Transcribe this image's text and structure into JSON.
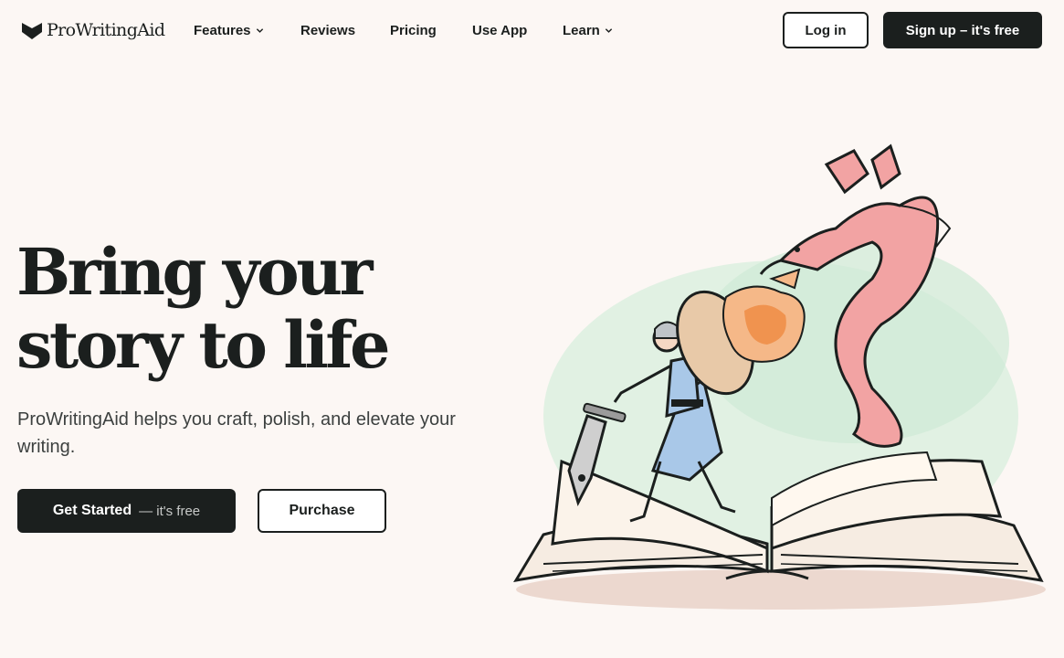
{
  "brand": {
    "name": "ProWritingAid"
  },
  "nav": {
    "items": [
      {
        "label": "Features",
        "dropdown": true
      },
      {
        "label": "Reviews",
        "dropdown": false
      },
      {
        "label": "Pricing",
        "dropdown": false
      },
      {
        "label": "Use App",
        "dropdown": false
      },
      {
        "label": "Learn",
        "dropdown": true
      }
    ],
    "login_label": "Log in",
    "signup_label": "Sign up – it's free"
  },
  "hero": {
    "headline_line1": "Bring your",
    "headline_line2": "story to life",
    "subtext": "ProWritingAid helps you craft, polish, and elevate your writing.",
    "cta_primary_main": "Get Started",
    "cta_primary_sub": "— it's free",
    "cta_secondary": "Purchase"
  },
  "colors": {
    "background": "#fcf7f4",
    "ink": "#1b1f1e",
    "dragon": "#f2a3a3",
    "knight_tunic": "#a9c8e8",
    "wash_green": "#cfe9d6"
  },
  "icons": {
    "logo": "book-heart-logo-icon",
    "chevron": "chevron-down-icon"
  }
}
